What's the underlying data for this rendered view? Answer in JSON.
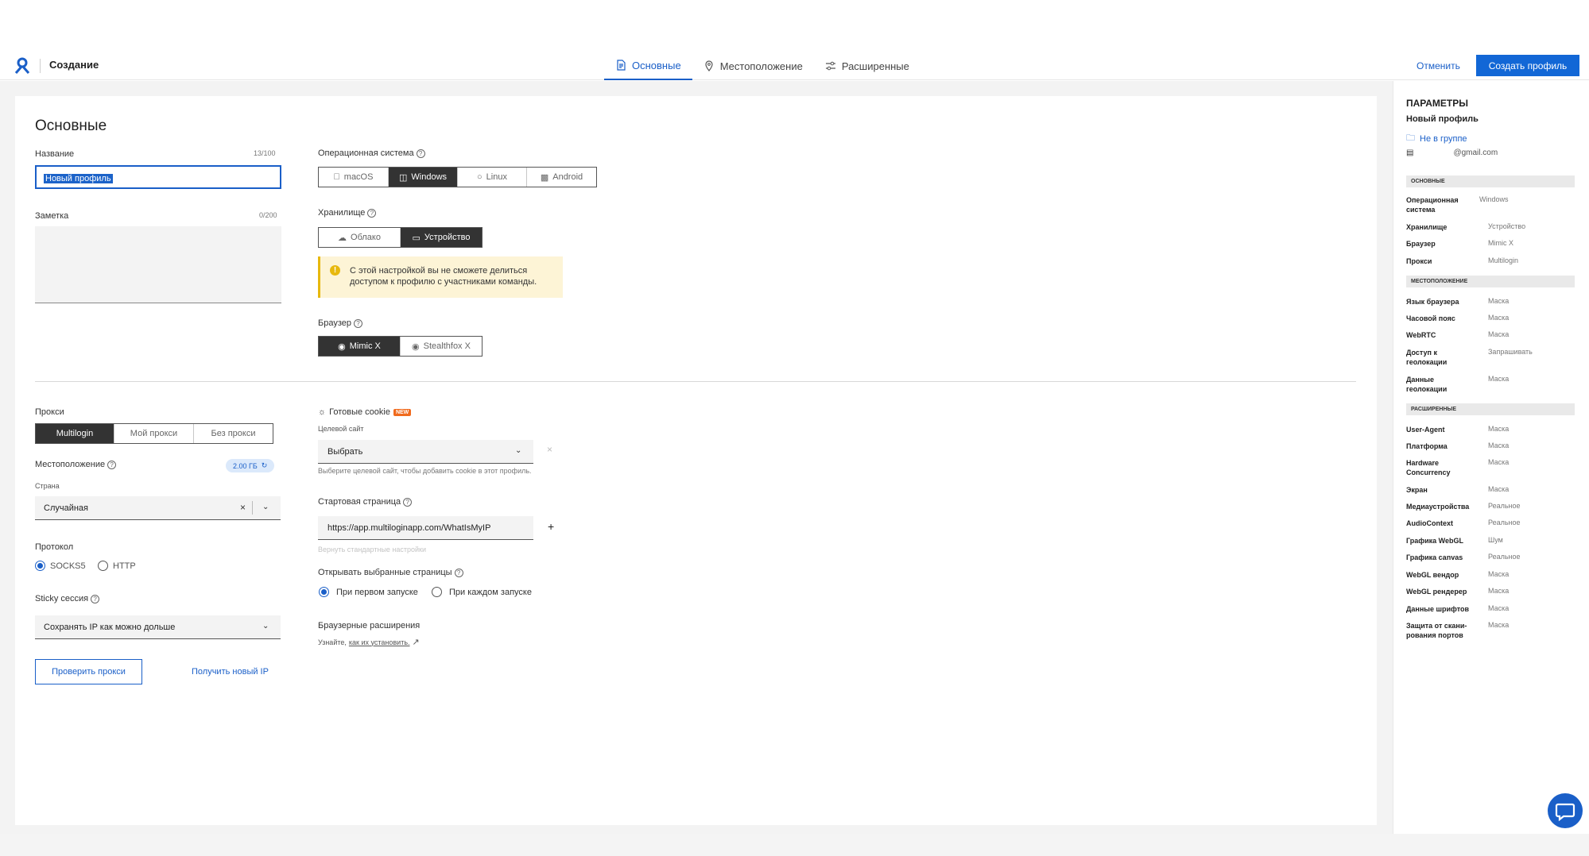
{
  "header": {
    "title": "Создание",
    "tabs": [
      {
        "label": "Основные",
        "icon": "document-icon",
        "active": true
      },
      {
        "label": "Местоположение",
        "icon": "location-pin-icon",
        "active": false
      },
      {
        "label": "Расширенные",
        "icon": "sliders-icon",
        "active": false
      }
    ],
    "cancel_label": "Отменить",
    "create_label": "Создать профиль"
  },
  "main": {
    "heading": "Основные",
    "name": {
      "label": "Название",
      "counter": "13/100",
      "value": "Новый профиль"
    },
    "note": {
      "label": "Заметка",
      "counter": "0/200"
    },
    "os": {
      "label": "Операционная система",
      "options": [
        "macOS",
        "Windows",
        "Linux",
        "Android"
      ],
      "selected": "Windows"
    },
    "storage": {
      "label": "Хранилище",
      "options": [
        "Облако",
        "Устройство"
      ],
      "selected": "Устройство",
      "warning": "С этой настройкой вы не сможете делиться доступом к профилю с участниками команды."
    },
    "browser": {
      "label": "Браузер",
      "options": [
        "Mimic X",
        "Stealthfox X"
      ],
      "selected": "Mimic X"
    },
    "proxy": {
      "label": "Прокси",
      "options": [
        "Multilogin",
        "Мой прокси",
        "Без прокси"
      ],
      "selected": "Multilogin",
      "location_label": "Местоположение",
      "traffic": "2.00 ГБ",
      "country_label": "Страна",
      "country_value": "Случайная",
      "protocol_label": "Протокол",
      "protocols": [
        "SOCKS5",
        "HTTP"
      ],
      "protocol_selected": "SOCKS5",
      "sticky_label": "Sticky сессия",
      "sticky_value": "Сохранять IP как можно дольше",
      "check_label": "Проверить прокси",
      "new_ip_label": "Получить новый IP"
    },
    "cookies": {
      "label": "Готовые cookie",
      "badge": "NEW",
      "target_label": "Целевой сайт",
      "target_value": "Выбрать",
      "hint": "Выберите целевой сайт, чтобы добавить cookie в этот профиль."
    },
    "start_page": {
      "label": "Стартовая страница",
      "value": "https://app.multiloginapp.com/WhatIsMyIP",
      "reset": "Вернуть стандартные настройки"
    },
    "open_pages": {
      "label": "Открывать выбранные страницы",
      "options": [
        "При первом запуске",
        "При каждом запуске"
      ],
      "selected": "При первом запуске"
    },
    "extensions": {
      "label": "Браузерные расширения",
      "hint_prefix": "Узнайте,",
      "hint_link": "как их установить."
    }
  },
  "sidebar": {
    "title": "ПАРАМЕТРЫ",
    "profile_name": "Новый профиль",
    "group": "Не в группе",
    "email": "@gmail.com",
    "sections": [
      {
        "title": "ОСНОВНЫЕ",
        "rows": [
          {
            "k": "Операционная система",
            "v": "Windows"
          },
          {
            "k": "Хранилище",
            "v": "Устройство"
          },
          {
            "k": "Браузер",
            "v": "Mimic X"
          },
          {
            "k": "Прокси",
            "v": "Multilogin"
          }
        ]
      },
      {
        "title": "МЕСТОПОЛОЖЕНИЕ",
        "rows": [
          {
            "k": "Язык браузера",
            "v": "Маска"
          },
          {
            "k": "Часовой пояс",
            "v": "Маска"
          },
          {
            "k": "WebRTC",
            "v": "Маска"
          },
          {
            "k": "Доступ к геолокации",
            "v": "Запрашивать"
          },
          {
            "k": "Данные геолокации",
            "v": "Маска"
          }
        ]
      },
      {
        "title": "РАСШИРЕННЫЕ",
        "rows": [
          {
            "k": "User-Agent",
            "v": "Маска"
          },
          {
            "k": "Платформа",
            "v": "Маска"
          },
          {
            "k": "Hardware Concurrency",
            "v": "Маска"
          },
          {
            "k": "Экран",
            "v": "Маска"
          },
          {
            "k": "Медиаустройства",
            "v": "Реальное"
          },
          {
            "k": "AudioContext",
            "v": "Реальное"
          },
          {
            "k": "Графика WebGL",
            "v": "Шум"
          },
          {
            "k": "Графика canvas",
            "v": "Реальное"
          },
          {
            "k": "WebGL вендор",
            "v": "Маска"
          },
          {
            "k": "WebGL рендерер",
            "v": "Маска"
          },
          {
            "k": "Данные шрифтов",
            "v": "Маска"
          },
          {
            "k": "Защита от скани-рования портов",
            "v": "Маска"
          }
        ]
      }
    ]
  },
  "colors": {
    "accent": "#1267d6",
    "dark_segment": "#333333",
    "warning_bg": "#fdf4d6",
    "warning_border": "#e7b80e",
    "badge": "#f06a1d"
  }
}
